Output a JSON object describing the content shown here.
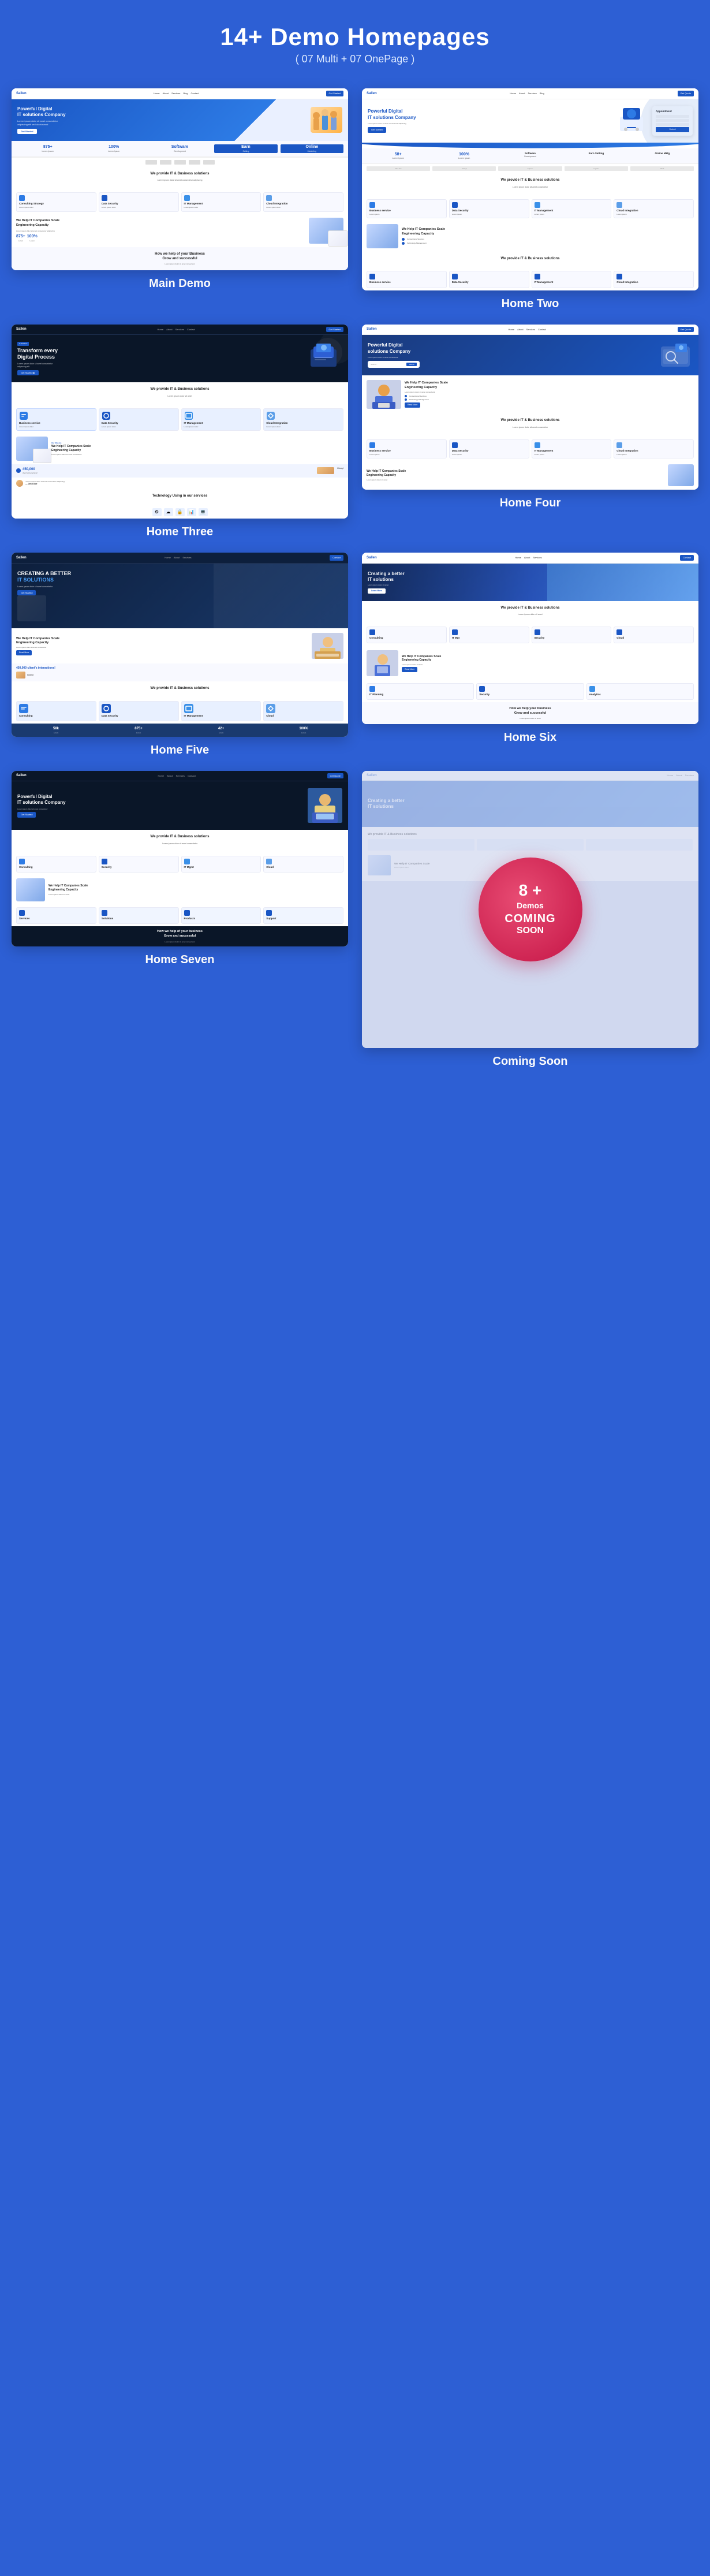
{
  "header": {
    "title": "14+ Demo Homepages",
    "subtitle": "( 07 Multi + 07 OnePage  )"
  },
  "demos": [
    {
      "id": "main-demo",
      "label": "Main Demo",
      "type": "main"
    },
    {
      "id": "home-two",
      "label": "Home Two",
      "type": "home2"
    },
    {
      "id": "home-three",
      "label": "Home Three",
      "type": "home3"
    },
    {
      "id": "home-four",
      "label": "Home Four",
      "type": "home4"
    },
    {
      "id": "home-five",
      "label": "Home Five",
      "type": "home5"
    },
    {
      "id": "home-six",
      "label": "Home Six",
      "type": "home6"
    },
    {
      "id": "home-seven",
      "label": "Home Seven",
      "type": "home7"
    },
    {
      "id": "coming-soon",
      "label": "Coming Soon",
      "type": "coming-soon"
    }
  ],
  "main_demo": {
    "nav_logo": "Sallen",
    "hero_title": "Powerful Digital IT solutions Company",
    "hero_text": "Lorem ipsum dolor sit amet consectetur adipiscing elit sed do eiusmod tempor",
    "section_title": "We provide IT & Business solutions",
    "section2_title": "We Help IT Companies Scale Engineering Capacity",
    "stats": [
      {
        "num": "875+",
        "label": "Lorem Ipsum"
      },
      {
        "num": "100%",
        "label": "Lorem Ipsum"
      }
    ],
    "bottom_text": "How we help of your Business Grow and successful"
  },
  "home_two": {
    "nav_logo": "Sallen",
    "hero_title": "Powerful Digital IT solutions Company",
    "stats": [
      {
        "num": "58+",
        "label": "Lorem Ipsum"
      },
      {
        "num": "100%",
        "label": "Lorem Ipsum"
      }
    ],
    "logos": [
      "Win Tier",
      "Cheryl",
      "Capser",
      "Ingsite",
      "DICA"
    ],
    "section_title": "We provide IT & Business solutions"
  },
  "home_three": {
    "nav_logo": "Sallen",
    "hero_title": "Transform every Digital Process",
    "section_title": "We provide IT & Business solutions",
    "counter_text": "450,000 client's interactions!",
    "tech_title": "Technology Using in our services",
    "section2_title": "We Help IT Companies Scale Engineering Capacity"
  },
  "home_four": {
    "nav_logo": "Sallen",
    "hero_title": "Powerful Digital solutions Company",
    "section_title": "We Help IT Companies Scale Engineering Capacity",
    "section2_title": "We provide IT & Business solutions"
  },
  "home_five": {
    "nav_logo": "Sallen",
    "hero_title": "CREATING A BETTER IT SOLUTIONS",
    "section_title": "We Help IT Companies Scale Engineering Capacity",
    "counter_text": "450,000 client's interactions!",
    "section2_title": "We provide IT & Business solutions",
    "bottom_stats": [
      {
        "num": "58k",
        "label": "Lorem"
      },
      {
        "num": "875+",
        "label": "Lorem"
      },
      {
        "num": "42+",
        "label": "Lorem"
      },
      {
        "num": "100%",
        "label": "Lorem"
      }
    ]
  },
  "home_six": {
    "nav_logo": "Sallen",
    "hero_title": "Creating a better IT solutions",
    "section_title": "We provide IT & Business solutions",
    "section2_title": "We Help IT Companies Scale Engineering Capacity",
    "bottom_text": "How we help your business Grow and successful"
  },
  "home_seven": {
    "nav_logo": "Sallen",
    "hero_title": "Powerful Digital IT solutions Company",
    "section_title": "We provide IT & Business solutions",
    "bottom_text": "How we help of your business Grow and successful"
  },
  "coming_soon": {
    "num": "8 +",
    "demos_label": "Demos",
    "text1": "COMING",
    "text2": "SOON"
  },
  "colors": {
    "brand_blue": "#1a56c4",
    "dark_navy": "#0a1628",
    "bg_blue": "#2d5fd4"
  }
}
